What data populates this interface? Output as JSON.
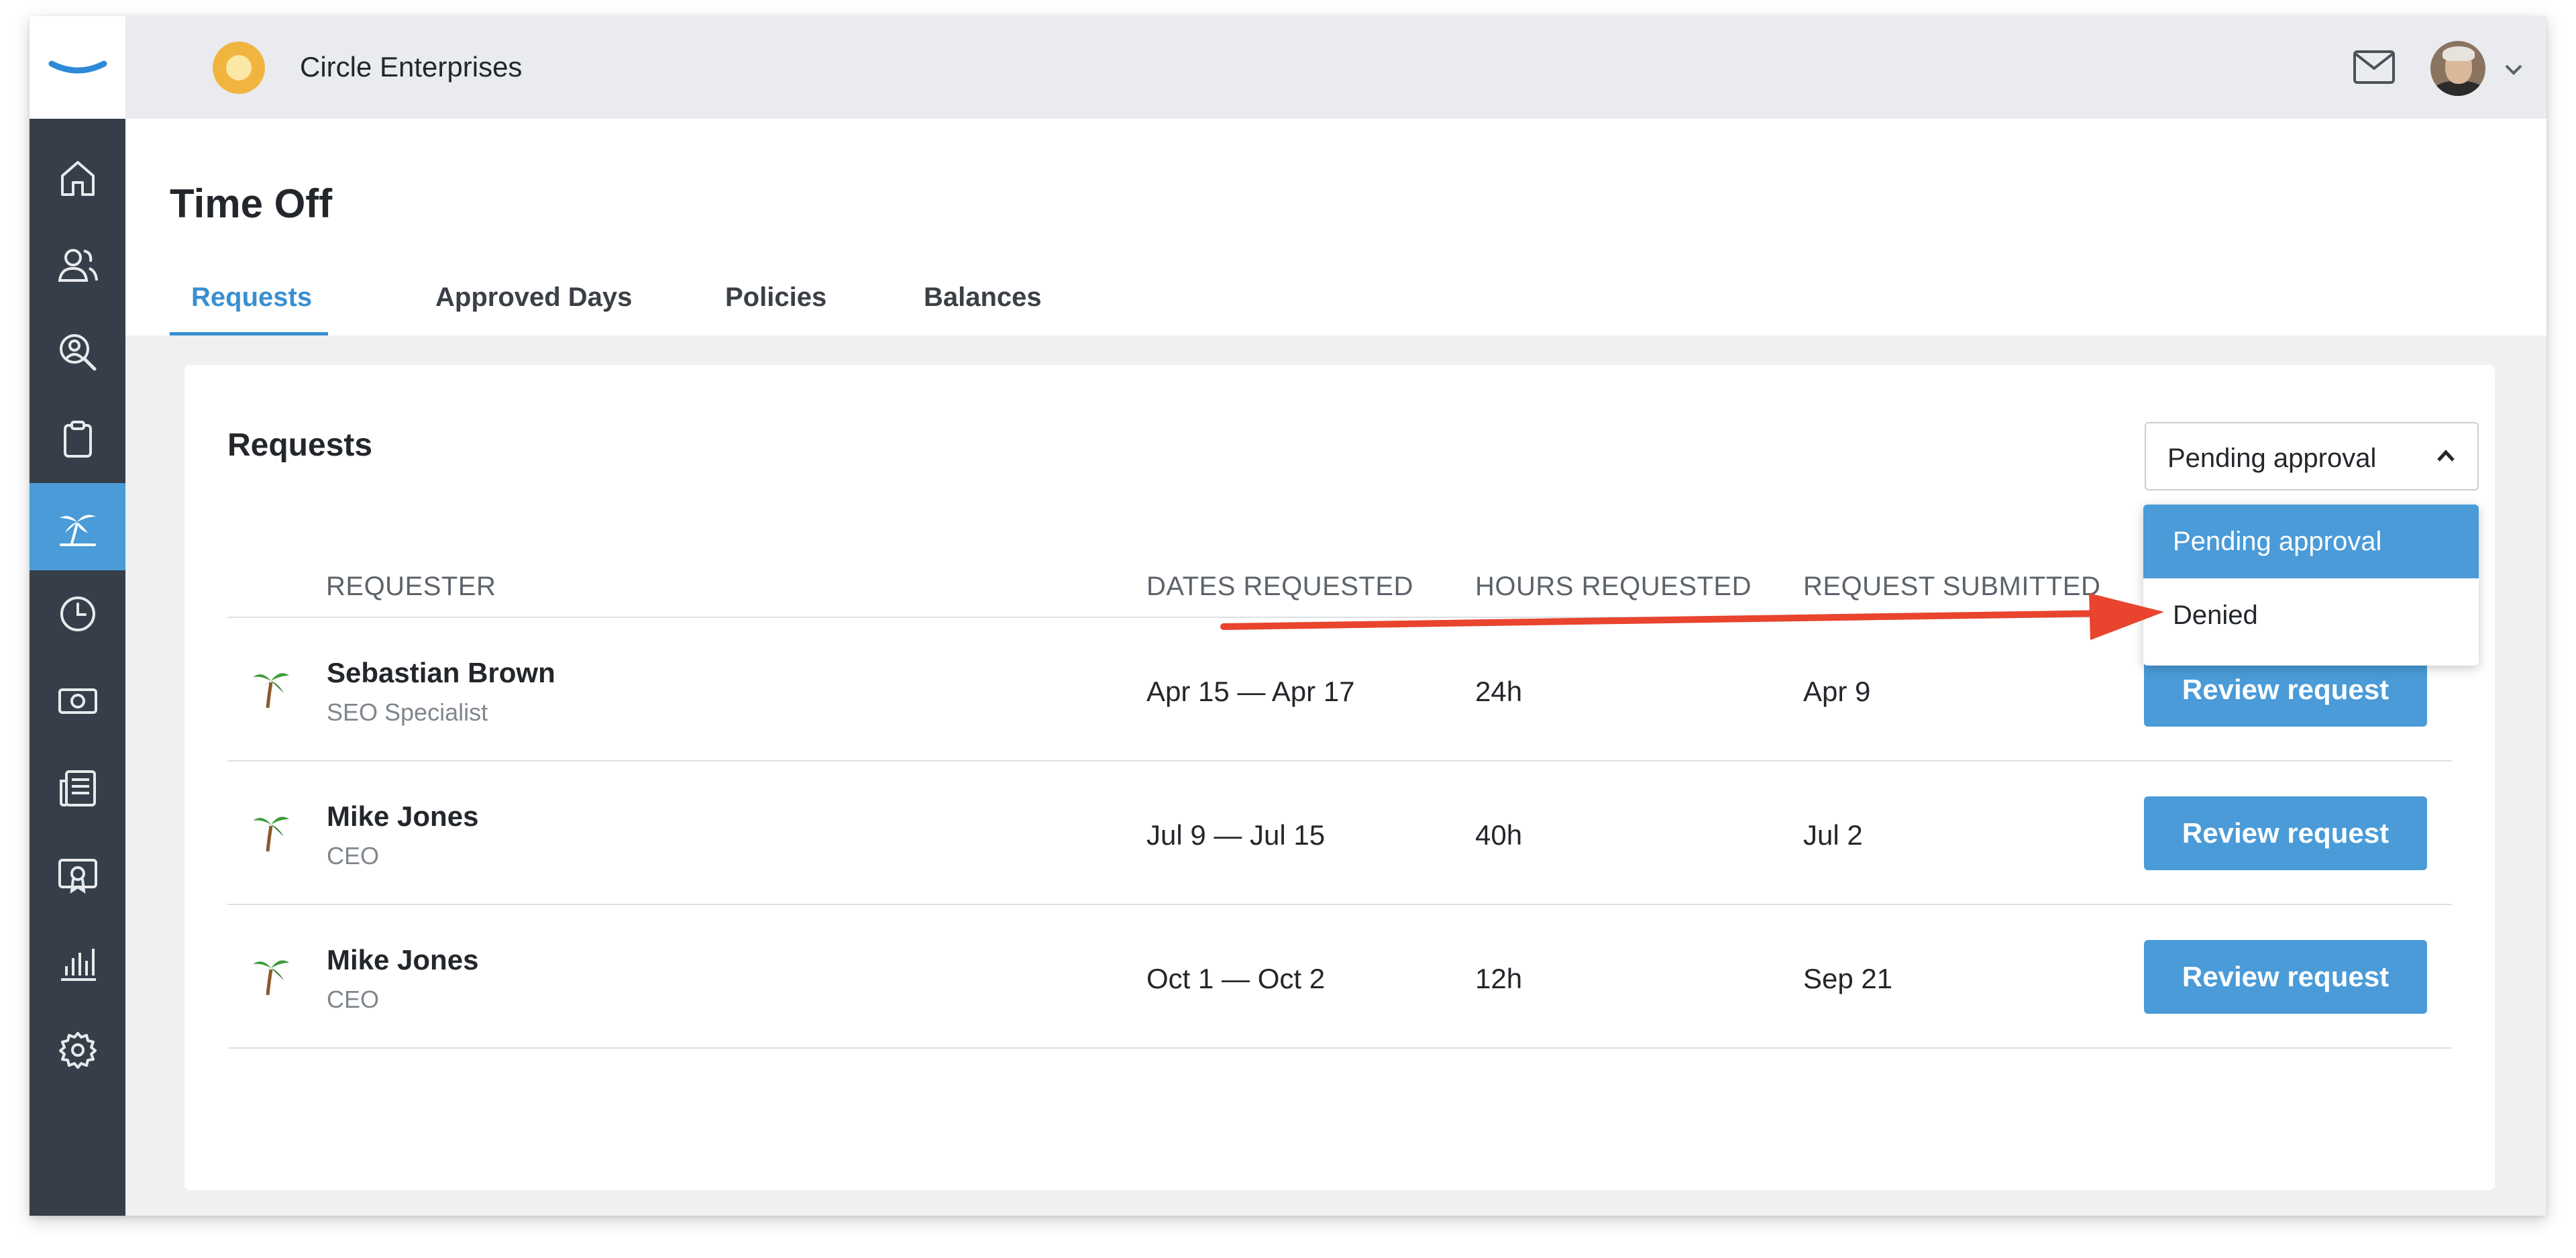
{
  "company": {
    "name": "Circle Enterprises"
  },
  "sidebar": {
    "items": [
      {
        "icon": "home-icon"
      },
      {
        "icon": "people-icon"
      },
      {
        "icon": "search-person-icon"
      },
      {
        "icon": "clipboard-icon"
      },
      {
        "icon": "palm-tree-icon",
        "active": true
      },
      {
        "icon": "clock-icon"
      },
      {
        "icon": "money-icon"
      },
      {
        "icon": "news-icon"
      },
      {
        "icon": "certificate-icon"
      },
      {
        "icon": "bar-chart-icon"
      },
      {
        "icon": "gear-icon"
      }
    ]
  },
  "page": {
    "title": "Time Off",
    "tabs": [
      {
        "label": "Requests",
        "active": true
      },
      {
        "label": "Approved Days"
      },
      {
        "label": "Policies"
      },
      {
        "label": "Balances"
      }
    ]
  },
  "card": {
    "title": "Requests",
    "filter": {
      "value": "Pending approval",
      "options": [
        "Pending approval",
        "Denied"
      ]
    },
    "columns": [
      "REQUESTER",
      "DATES REQUESTED",
      "HOURS REQUESTED",
      "REQUEST SUBMITTED"
    ],
    "rows": [
      {
        "name": "Sebastian Brown",
        "role": "SEO Specialist",
        "dates": "Apr 15 — Apr 17",
        "hours": "24h",
        "submitted": "Apr 9",
        "action": "Review request"
      },
      {
        "name": "Mike Jones",
        "role": "CEO",
        "dates": "Jul 9 — Jul 15",
        "hours": "40h",
        "submitted": "Jul 2",
        "action": "Review request"
      },
      {
        "name": "Mike Jones",
        "role": "CEO",
        "dates": "Oct 1 — Oct 2",
        "hours": "12h",
        "submitted": "Sep 21",
        "action": "Review request"
      }
    ]
  },
  "colors": {
    "accent": "#4a9bd8",
    "sidebar": "#363f49",
    "annotation": "#e8442e"
  }
}
